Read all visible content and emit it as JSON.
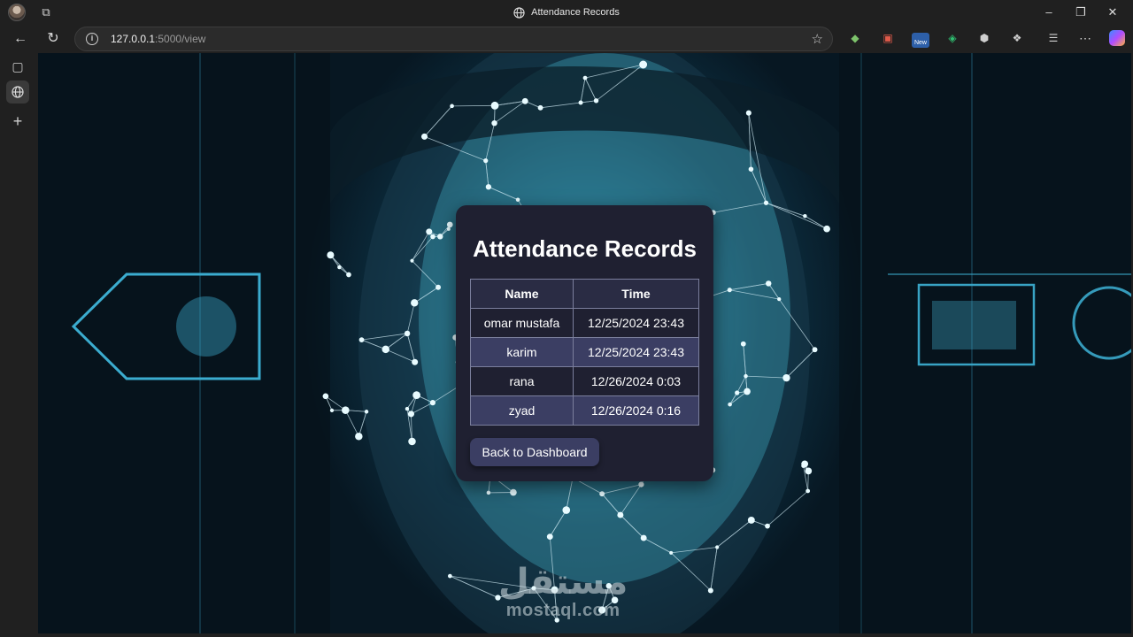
{
  "window": {
    "title": "Attendance Records",
    "minimize_icon": "minimize-icon",
    "maximize_icon": "restore-icon",
    "close_icon": "close-icon"
  },
  "address_bar": {
    "url_host": "127.0.0.1",
    "url_rest": ":5000/view",
    "extension_badge": "New"
  },
  "page": {
    "heading": "Attendance Records",
    "table": {
      "columns": [
        "Name",
        "Time"
      ],
      "rows": [
        {
          "name": "omar mustafa",
          "time": "12/25/2024 23:43"
        },
        {
          "name": "karim",
          "time": "12/25/2024 23:43"
        },
        {
          "name": "rana",
          "time": "12/26/2024 0:03"
        },
        {
          "name": "zyad",
          "time": "12/26/2024 0:16"
        }
      ]
    },
    "back_button": "Back to Dashboard"
  },
  "watermark": {
    "arabic": "مستقل",
    "latin": "mostaql.com"
  },
  "colors": {
    "card_bg": "#1f2031",
    "row_alt": "#3b3e63",
    "button_bg": "#3b3e63"
  }
}
